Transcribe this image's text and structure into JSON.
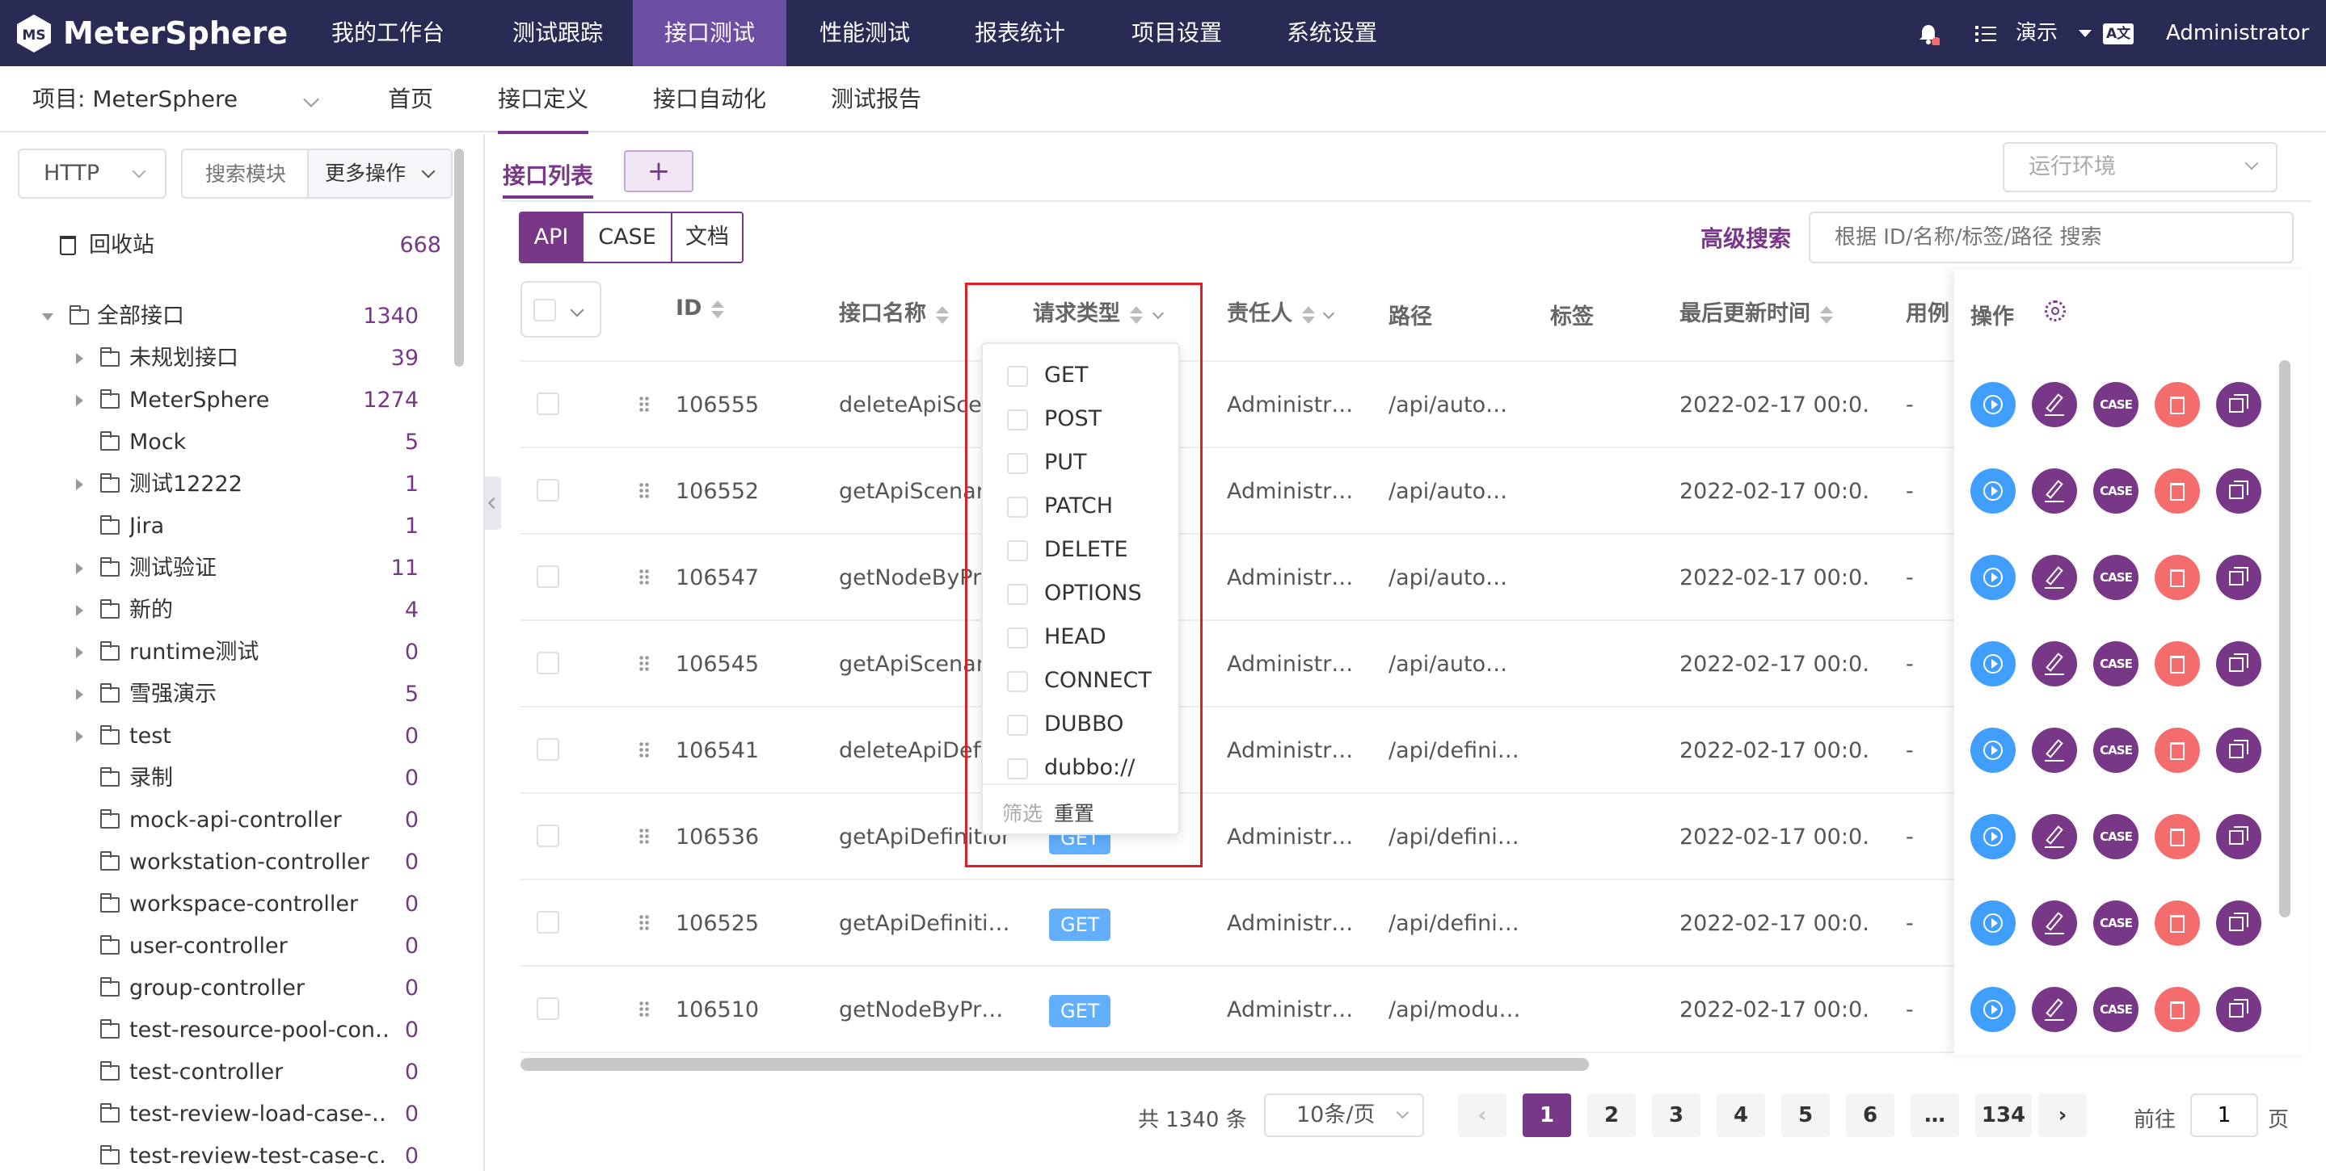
{
  "app": {
    "logo_text": "MeterSphere"
  },
  "topnav": {
    "items": [
      "我的工作台",
      "测试跟踪",
      "接口测试",
      "性能测试",
      "报表统计",
      "项目设置",
      "系统设置"
    ],
    "workspace": "演示",
    "user": "Administrator",
    "lang_icon": "A文"
  },
  "subnav": {
    "project": "项目: MeterSphere",
    "tabs": [
      "首页",
      "接口定义",
      "接口自动化",
      "测试报告"
    ]
  },
  "sidebar": {
    "protocol": "HTTP",
    "search_placeholder": "搜索模块",
    "more_ops": "更多操作",
    "recycle": {
      "label": "回收站",
      "count": "668"
    },
    "root": {
      "label": "全部接口",
      "count": "1340"
    },
    "items": [
      {
        "label": "未规划接口",
        "count": "39"
      },
      {
        "label": "MeterSphere",
        "count": "1274"
      },
      {
        "label": "Mock",
        "count": "5"
      },
      {
        "label": "测试12222",
        "count": "1"
      },
      {
        "label": "Jira",
        "count": "1"
      },
      {
        "label": "测试验证",
        "count": "11"
      },
      {
        "label": "新的",
        "count": "4"
      },
      {
        "label": "runtime测试",
        "count": "0"
      },
      {
        "label": "雪强演示",
        "count": "5"
      },
      {
        "label": "test",
        "count": "0"
      },
      {
        "label": "录制",
        "count": "0"
      },
      {
        "label": "mock-api-controller",
        "count": "0"
      },
      {
        "label": "workstation-controller",
        "count": "0"
      },
      {
        "label": "workspace-controller",
        "count": "0"
      },
      {
        "label": "user-controller",
        "count": "0"
      },
      {
        "label": "group-controller",
        "count": "0"
      },
      {
        "label": "test-resource-pool-con…",
        "count": "0"
      },
      {
        "label": "test-controller",
        "count": "0"
      },
      {
        "label": "test-review-load-case-…",
        "count": "0"
      },
      {
        "label": "test-review-test-case-c…",
        "count": "0"
      }
    ]
  },
  "main": {
    "tab_label": "接口列表",
    "add_tab": "+",
    "env_placeholder": "运行环境",
    "modes": [
      "API",
      "CASE",
      "文档"
    ],
    "advanced_search": "高级搜索",
    "search_placeholder": "根据 ID/名称/标签/路径 搜索",
    "columns": {
      "id": "ID",
      "name": "接口名称",
      "method": "请求类型",
      "owner": "责任人",
      "path": "路径",
      "tags": "标签",
      "updated": "最后更新时间",
      "cases": "用例",
      "actions": "操作"
    },
    "rows": [
      {
        "id": "106555",
        "name": "deleteApiSce…",
        "method": "",
        "owner": "Administr…",
        "path": "/api/auto…",
        "updated": "2022-02-17 00:0…",
        "cases": "-"
      },
      {
        "id": "106552",
        "name": "getApiScenari…",
        "method": "",
        "owner": "Administr…",
        "path": "/api/auto…",
        "updated": "2022-02-17 00:0…",
        "cases": "-"
      },
      {
        "id": "106547",
        "name": "getNodeByPr…",
        "method": "",
        "owner": "Administr…",
        "path": "/api/auto…",
        "updated": "2022-02-17 00:0…",
        "cases": "-"
      },
      {
        "id": "106545",
        "name": "getApiScenar…",
        "method": "",
        "owner": "Administr…",
        "path": "/api/auto…",
        "updated": "2022-02-17 00:0…",
        "cases": "-"
      },
      {
        "id": "106541",
        "name": "deleteApiDefi…",
        "method": "",
        "owner": "Administr…",
        "path": "/api/defini…",
        "updated": "2022-02-17 00:0…",
        "cases": "-"
      },
      {
        "id": "106536",
        "name": "getApiDefinition…",
        "method": "GET",
        "owner": "Administr…",
        "path": "/api/defini…",
        "updated": "2022-02-17 00:0…",
        "cases": "-"
      },
      {
        "id": "106525",
        "name": "getApiDefiniti…",
        "method": "GET",
        "owner": "Administr…",
        "path": "/api/defini…",
        "updated": "2022-02-17 00:0…",
        "cases": "-"
      },
      {
        "id": "106510",
        "name": "getNodeByPr…",
        "method": "GET",
        "owner": "Administr…",
        "path": "/api/modu…",
        "updated": "2022-02-17 00:0…",
        "cases": "-"
      }
    ],
    "action_case_label": "CASE"
  },
  "filter": {
    "options": [
      "GET",
      "POST",
      "PUT",
      "PATCH",
      "DELETE",
      "OPTIONS",
      "HEAD",
      "CONNECT",
      "DUBBO",
      "dubbo://"
    ],
    "confirm": "筛选",
    "reset": "重置"
  },
  "pagination": {
    "total": "共 1340 条",
    "page_size": "10条/页",
    "pages": [
      "1",
      "2",
      "3",
      "4",
      "5",
      "6",
      "…",
      "134"
    ],
    "goto_label": "前往",
    "goto_value": "1",
    "page_suffix": "页"
  },
  "colors": {
    "brand": "#783887",
    "topbar": "#2a2b55",
    "get": "#61affe",
    "highlight": "#e02020"
  }
}
